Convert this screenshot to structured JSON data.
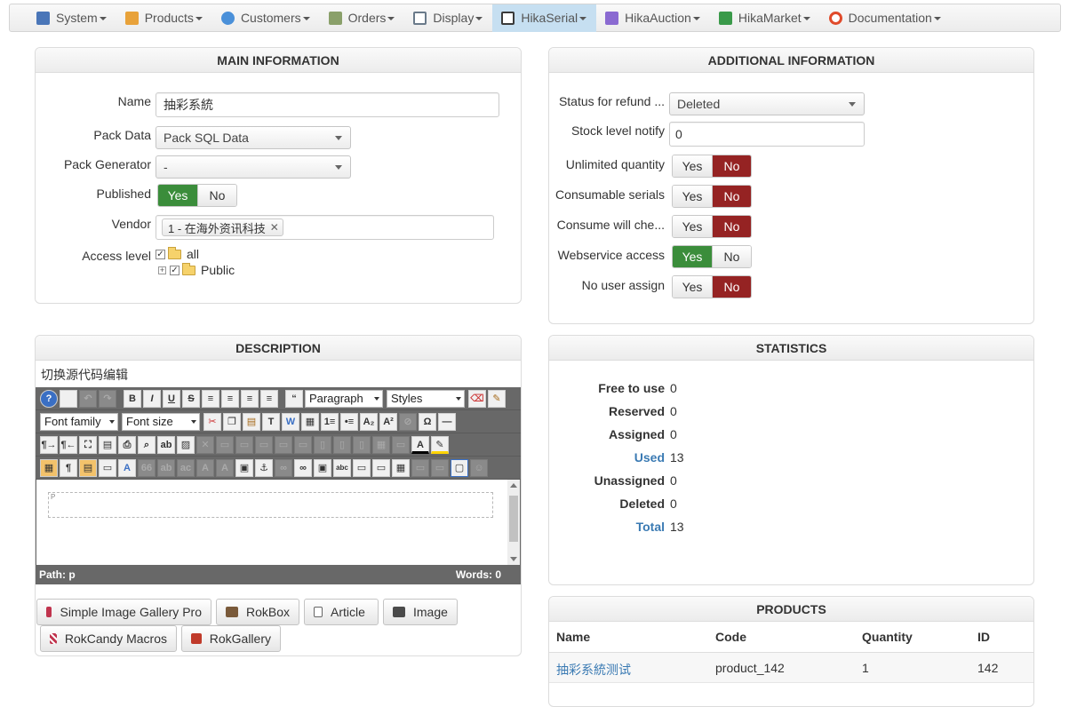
{
  "menu": [
    {
      "label": "System",
      "icon": "wrench-icon",
      "color": "#4a76b8"
    },
    {
      "label": "Products",
      "icon": "box-icon",
      "color": "#e8a23a"
    },
    {
      "label": "Customers",
      "icon": "users-icon",
      "color": "#4a90d9"
    },
    {
      "label": "Orders",
      "icon": "orders-icon",
      "color": "#8aa06a"
    },
    {
      "label": "Display",
      "icon": "display-icon",
      "color": "#6a7a8a"
    },
    {
      "label": "HikaSerial",
      "icon": "serial-icon",
      "color": "#3a3a3a",
      "active": true
    },
    {
      "label": "HikaAuction",
      "icon": "auction-icon",
      "color": "#8a6ad1"
    },
    {
      "label": "HikaMarket",
      "icon": "market-icon",
      "color": "#3a9a4a"
    },
    {
      "label": "Documentation",
      "icon": "lifebuoy-icon",
      "color": "#e04a2a"
    }
  ],
  "main_info": {
    "title": "MAIN INFORMATION",
    "name_label": "Name",
    "name_value": "抽彩系統",
    "pack_data_label": "Pack Data",
    "pack_data_value": "Pack SQL Data",
    "pack_generator_label": "Pack Generator",
    "pack_generator_value": "-",
    "published_label": "Published",
    "yes": "Yes",
    "no": "No",
    "vendor_label": "Vendor",
    "vendor_tag": "1 - 在海外资讯科技",
    "vendor_remove": "✕",
    "access_label": "Access level",
    "access_all": "all",
    "access_public": "Public"
  },
  "additional_info": {
    "title": "ADDITIONAL INFORMATION",
    "status_refund_label": "Status for refund ...",
    "status_refund_value": "Deleted",
    "stock_notify_label": "Stock level notify",
    "stock_notify_value": "0",
    "unlimited_label": "Unlimited quantity",
    "consumable_label": "Consumable serials",
    "consume_check_label": "Consume will che...",
    "webservice_label": "Webservice access",
    "no_user_label": "No user assign",
    "yes": "Yes",
    "no": "No"
  },
  "description": {
    "title": "DESCRIPTION",
    "toggle_link": "切换源代码编辑",
    "format_value": "Paragraph",
    "styles_value": "Styles",
    "font_family_value": "Font family",
    "font_size_value": "Font size",
    "placeholder_tag": "P",
    "path_label": "Path: p",
    "words_label": "Words: 0",
    "buttons": [
      "Simple Image Gallery Pro",
      "RokBox",
      "Article",
      "Image",
      "RokCandy Macros",
      "RokGallery"
    ]
  },
  "statistics": {
    "title": "STATISTICS",
    "rows": [
      {
        "label": "Free to use",
        "value": "0",
        "link": false
      },
      {
        "label": "Reserved",
        "value": "0",
        "link": false
      },
      {
        "label": "Assigned",
        "value": "0",
        "link": false
      },
      {
        "label": "Used",
        "value": "13",
        "link": true
      },
      {
        "label": "Unassigned",
        "value": "0",
        "link": false
      },
      {
        "label": "Deleted",
        "value": "0",
        "link": false
      },
      {
        "label": "Total",
        "value": "13",
        "link": true
      }
    ]
  },
  "products": {
    "title": "PRODUCTS",
    "headers": [
      "Name",
      "Code",
      "Quantity",
      "ID"
    ],
    "rows": [
      {
        "name": "抽彩系統测试",
        "code": "product_142",
        "quantity": "1",
        "id": "142"
      }
    ]
  }
}
